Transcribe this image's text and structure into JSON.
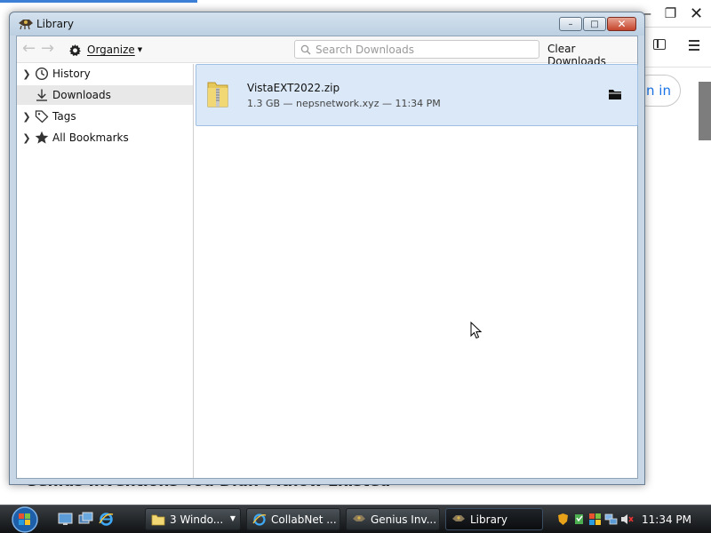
{
  "background_page": {
    "signin_label": "n in",
    "headline_partial": "Genius Inventions You Didn't Know Existed"
  },
  "library": {
    "title": "Library",
    "window_buttons": {
      "minimize": "–",
      "maximize": "□",
      "close": "✕"
    },
    "toolbar": {
      "organize_label": "Organize",
      "search_placeholder": "Search Downloads",
      "clear_label": "Clear Downloads"
    },
    "sidebar": {
      "items": [
        {
          "label": "History",
          "icon": "clock-icon",
          "expandable": true
        },
        {
          "label": "Downloads",
          "icon": "download-arrow-icon",
          "expandable": false,
          "selected": true
        },
        {
          "label": "Tags",
          "icon": "tag-icon",
          "expandable": true
        },
        {
          "label": "All Bookmarks",
          "icon": "star-icon",
          "expandable": true
        }
      ]
    },
    "downloads": [
      {
        "filename": "VistaEXT2022.zip",
        "meta": "1.3 GB — nepsnetwork.xyz — 11:34 PM",
        "icon": "zip-folder-icon"
      }
    ]
  },
  "taskbar": {
    "buttons": [
      {
        "label": "3 Windo...",
        "icon": "folder-icon"
      },
      {
        "label": "CollabNet ...",
        "icon": "ie-icon"
      },
      {
        "label": "Genius Inv...",
        "icon": "firefox-icon"
      },
      {
        "label": "Library",
        "icon": "firefox-icon"
      }
    ],
    "clock": "11:34 PM"
  }
}
